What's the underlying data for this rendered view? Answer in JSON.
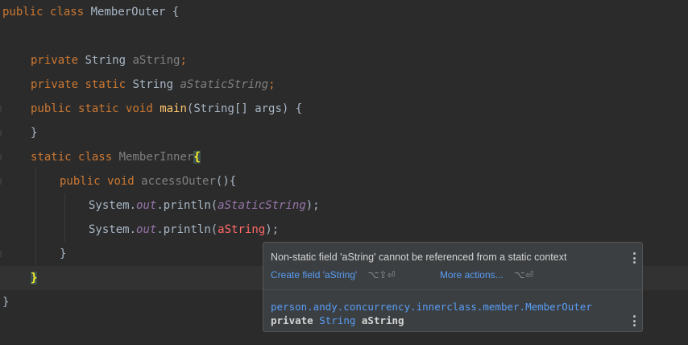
{
  "editor": {
    "lines": {
      "l1": {
        "kw1": "public",
        "kw2": "class",
        "name": "MemberOuter",
        "brace": "{"
      },
      "l3": {
        "kw": "private",
        "type": "String",
        "field": "aString",
        "semi": ";"
      },
      "l4": {
        "kw1": "private",
        "kw2": "static",
        "type": "String",
        "field": "aStaticString",
        "semi": ";"
      },
      "l5": {
        "kw1": "public",
        "kw2": "static",
        "kw3": "void",
        "method": "main",
        "params": "(String[] args) {"
      },
      "l6": {
        "text": "}"
      },
      "l7": {
        "kw1": "static",
        "kw2": "class",
        "name": "MemberInner",
        "brace": "{"
      },
      "l8": {
        "kw1": "public",
        "kw2": "void",
        "method": "accessOuter",
        "rest": "(){"
      },
      "l9": {
        "pre": "System.",
        "out": "out",
        "mid": ".println(",
        "arg": "aStaticString",
        "post": ");"
      },
      "l10": {
        "pre": "System.",
        "out": "out",
        "mid": ".println(",
        "arg": "aString",
        "post": ");"
      },
      "l11": {
        "text": "}"
      },
      "l12": {
        "text": "}"
      },
      "l13": {
        "text": "}"
      }
    }
  },
  "popup": {
    "message": "Non-static field 'aString' cannot be referenced from a static context",
    "create_field_label": "Create field 'aString'",
    "create_field_shortcut": "⌥⇧⏎",
    "more_actions_label": "More actions...",
    "more_actions_shortcut": "⌥⏎",
    "declaration": {
      "package": "person.andy.concurrency.innerclass.member.MemberOuter",
      "modifier": "private",
      "type": "String",
      "name": "aString"
    }
  }
}
